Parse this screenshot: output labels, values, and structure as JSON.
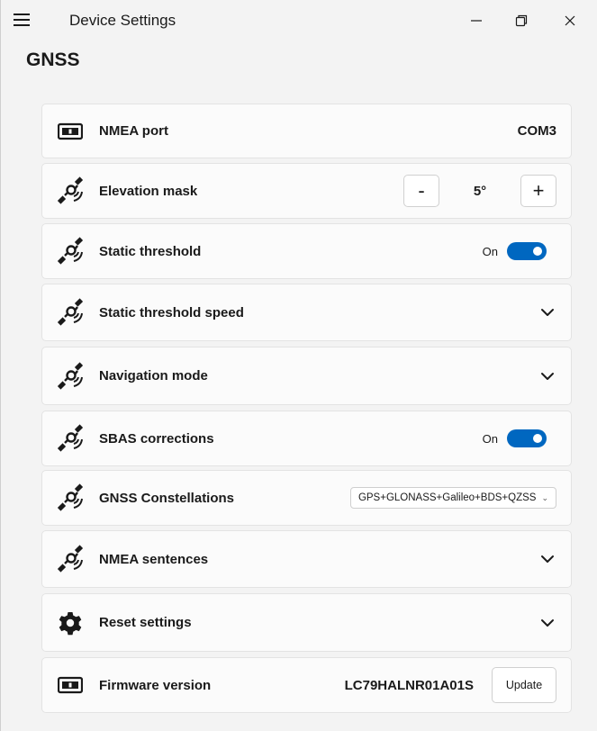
{
  "window": {
    "title": "Device Settings"
  },
  "page": {
    "title": "GNSS"
  },
  "settings": [
    {
      "label": "NMEA port",
      "icon": "serial-port-icon",
      "value": "COM3"
    },
    {
      "label": "Elevation mask",
      "icon": "satellite-icon",
      "minus": "-",
      "value": "5°",
      "plus": "+"
    },
    {
      "label": "Static threshold",
      "icon": "satellite-icon",
      "toggle_label": "On"
    },
    {
      "label": "Static threshold speed",
      "icon": "satellite-icon"
    },
    {
      "label": "Navigation mode",
      "icon": "satellite-icon"
    },
    {
      "label": "SBAS corrections",
      "icon": "satellite-icon",
      "toggle_label": "On"
    },
    {
      "label": "GNSS Constellations",
      "icon": "satellite-icon",
      "selected": "GPS+GLONASS+Galileo+BDS+QZSS"
    },
    {
      "label": "NMEA sentences",
      "icon": "satellite-icon"
    },
    {
      "label": "Reset settings",
      "icon": "gear-icon"
    },
    {
      "label": "Firmware version",
      "icon": "serial-port-icon",
      "value": "LC79HALNR01A01S",
      "button": "Update"
    }
  ],
  "colors": {
    "accent": "#0067c0",
    "background": "#f3f3f3",
    "card": "#fbfbfb"
  }
}
